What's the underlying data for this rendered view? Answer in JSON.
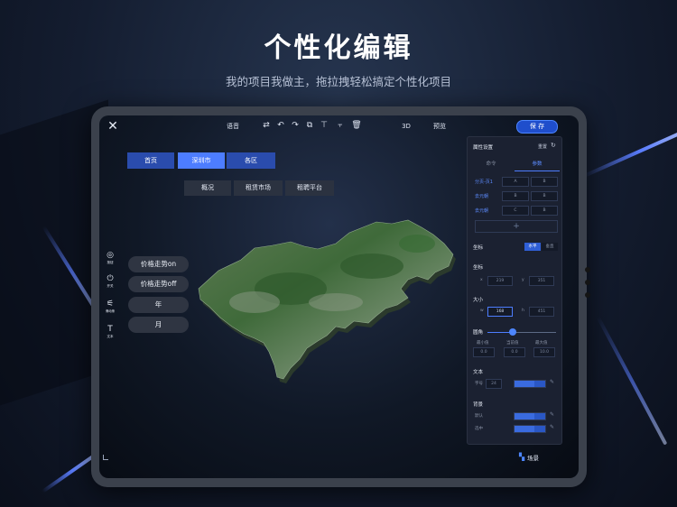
{
  "headline": "个性化编辑",
  "subline": "我的项目我做主，拖拉拽轻松搞定个性化项目",
  "toolbar": {
    "close_icon": "close-icon",
    "voice_label": "语音",
    "icons": [
      "swap-icon",
      "undo-icon",
      "redo-icon",
      "copy-icon",
      "align-top-icon",
      "align-center-icon",
      "delete-icon"
    ],
    "view3d_label": "3D",
    "preview_label": "预览",
    "save_label": "保 存"
  },
  "nav": {
    "items": [
      "首页",
      "深圳市",
      "各区"
    ],
    "active_index": 1
  },
  "subtabs": [
    "概况",
    "租赁市场",
    "租聘平台"
  ],
  "tools": [
    {
      "icon": "◎",
      "label": "按钮"
    },
    {
      "icon": "⏻",
      "label": "开关"
    },
    {
      "icon": "⚟",
      "label": "滑动条"
    },
    {
      "icon": "T",
      "label": "文本"
    }
  ],
  "chips": [
    "价格走势on",
    "价格走势off",
    "年",
    "月"
  ],
  "panel": {
    "title": "属性设置",
    "reset": "重置",
    "tabs": [
      "命令",
      "参数"
    ],
    "active_tab": 1,
    "rows": [
      {
        "label": "分页-页1",
        "cells": [
          "A",
          "B"
        ]
      },
      {
        "label": "去元朝",
        "cells": [
          "B",
          "B"
        ]
      },
      {
        "label": "去元朝",
        "cells": [
          "C",
          "B"
        ]
      }
    ],
    "add_symbol": "+",
    "coord_section": "坐标",
    "coord_toggle": [
      "水平",
      "垂直"
    ],
    "position_section": "坐标",
    "pos_x_label": "x",
    "pos_x": "219",
    "pos_y_label": "y",
    "pos_y": "351",
    "size_section": "大小",
    "size_w_label": "w",
    "size_w": "168",
    "size_h_label": "h",
    "size_h": "451",
    "radius_section": "圆角",
    "radius_min_label": "最小值",
    "radius_cur_label": "当前值",
    "radius_max_label": "最大值",
    "radius_min": "0.0",
    "radius_cur": "0.0",
    "radius_max": "10.0",
    "text_section": "文本",
    "font_size_label": "字号",
    "font_size": "24",
    "bg_section": "背景",
    "bg_default_label": "默认",
    "bg_selected_label": "选中",
    "accent_color": "#4d7dff"
  },
  "scene_label": "场景"
}
